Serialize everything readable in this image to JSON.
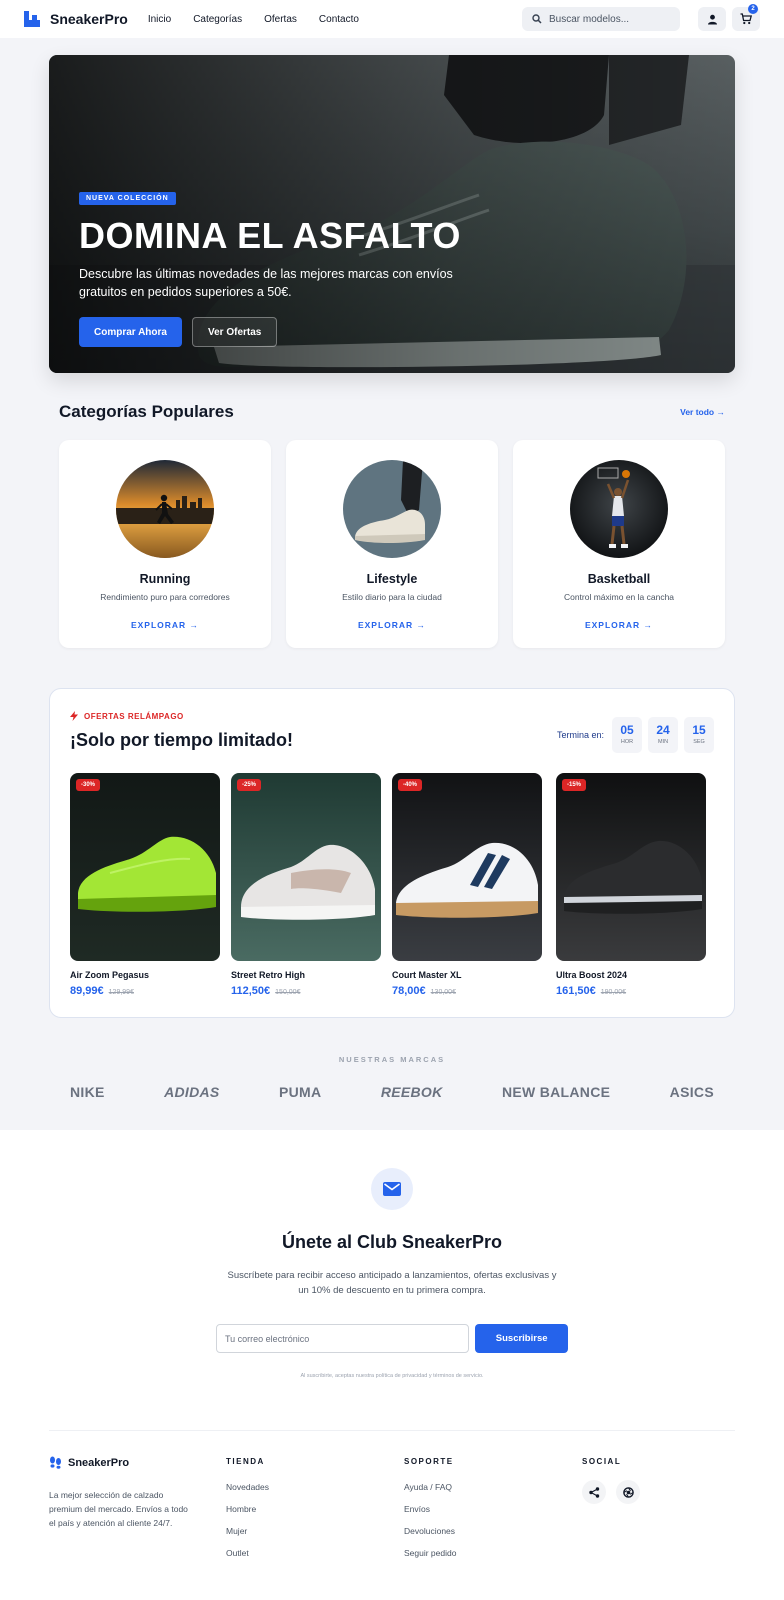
{
  "header": {
    "logo_text": "SneakerPro",
    "nav": [
      "Inicio",
      "Categorías",
      "Ofertas",
      "Contacto"
    ],
    "search_placeholder": "Buscar modelos...",
    "cart_count": "2"
  },
  "hero": {
    "tag": "NUEVA COLECCIÓN",
    "title": "DOMINA EL ASFALTO",
    "description": "Descubre las últimas novedades de las mejores marcas con envíos gratuitos en pedidos superiores a 50€.",
    "primary_button": "Comprar Ahora",
    "secondary_button": "Ver Ofertas"
  },
  "categories": {
    "title": "Categorías Populares",
    "view_all": "Ver todo →",
    "items": [
      {
        "name": "Running",
        "description": "Rendimiento puro para corredores",
        "link": "EXPLORAR →"
      },
      {
        "name": "Lifestyle",
        "description": "Estilo diario para la ciudad",
        "link": "EXPLORAR →"
      },
      {
        "name": "Basketball",
        "description": "Control máximo en la cancha",
        "link": "EXPLORAR →"
      }
    ]
  },
  "flash": {
    "tag": "OFERTAS RELÁMPAGO",
    "title": "¡Solo por tiempo limitado!",
    "timer_label": "Termina en:",
    "timer": [
      {
        "value": "05",
        "unit": "HOR"
      },
      {
        "value": "24",
        "unit": "MIN"
      },
      {
        "value": "15",
        "unit": "SEG"
      }
    ],
    "products": [
      {
        "discount": "-30%",
        "name": "Air Zoom Pegasus",
        "price": "89,99€",
        "old_price": "129,99€"
      },
      {
        "discount": "-25%",
        "name": "Street Retro High",
        "price": "112,50€",
        "old_price": "150,00€"
      },
      {
        "discount": "-40%",
        "name": "Court Master XL",
        "price": "78,00€",
        "old_price": "130,00€"
      },
      {
        "discount": "-15%",
        "name": "Ultra Boost 2024",
        "price": "161,50€",
        "old_price": "190,00€"
      }
    ]
  },
  "brands": {
    "label": "NUESTRAS MARCAS",
    "items": [
      "NIKE",
      "ADIDAS",
      "PUMA",
      "REEBOK",
      "NEW BALANCE",
      "ASICS"
    ]
  },
  "newsletter": {
    "title": "Únete al Club SneakerPro",
    "description": "Suscríbete para recibir acceso anticipado a lanzamientos, ofertas exclusivas y un 10% de descuento en tu primera compra.",
    "input_placeholder": "Tu correo electrónico",
    "button": "Suscribirse",
    "legal": "Al suscribirte, aceptas nuestra política de privacidad y términos de servicio."
  },
  "footer": {
    "brand": "SneakerPro",
    "about": "La mejor selección de calzado premium del mercado. Envíos a todo el país y atención al cliente 24/7.",
    "columns": [
      {
        "title": "TIENDA",
        "links": [
          "Novedades",
          "Hombre",
          "Mujer",
          "Outlet"
        ]
      },
      {
        "title": "SOPORTE",
        "links": [
          "Ayuda / FAQ",
          "Envíos",
          "Devoluciones",
          "Seguir pedido"
        ]
      }
    ],
    "social_title": "SOCIAL"
  },
  "colors": {
    "accent": "#2563eb",
    "sale": "#dc2626",
    "background": "#f3f4f8"
  },
  "icons": [
    "search-icon",
    "user-icon",
    "cart-icon",
    "bolt-icon",
    "mail-icon",
    "share-icon",
    "aperture-icon",
    "footprints-icon"
  ]
}
